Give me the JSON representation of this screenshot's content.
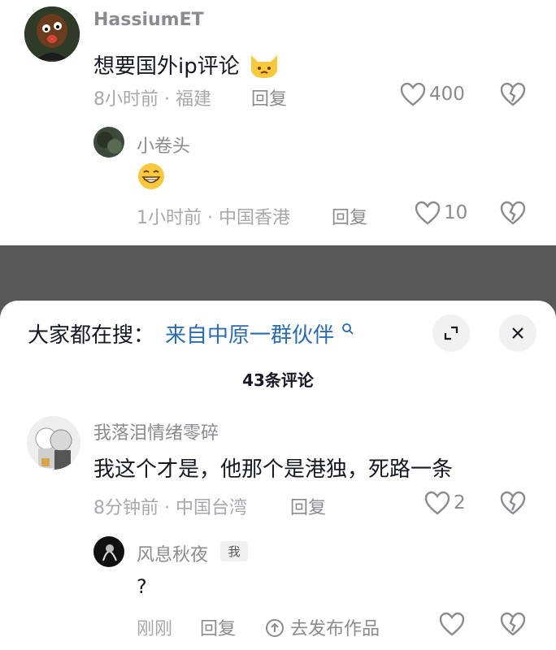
{
  "comments": [
    {
      "username": "HassiumET",
      "text": "想要国外ip评论",
      "emoji": "cat-face-emoji",
      "time": "8小时前",
      "location": "福建",
      "reply_label": "回复",
      "likes": "400",
      "reply": {
        "username": "小卷头",
        "emoji": "grin-emoji",
        "time": "1小时前",
        "location": "中国香港",
        "reply_label": "回复",
        "likes": "10"
      }
    }
  ],
  "panel": {
    "search_label": "大家都在搜：",
    "search_link": "来自中原一群伙伴",
    "comment_count": "43条评论",
    "comment": {
      "username": "我落泪情绪零碎",
      "text": "我这个才是，他那个是港独，死路一条",
      "time": "8分钟前",
      "location": "中国台湾",
      "reply_label": "回复",
      "likes": "2"
    },
    "my_reply": {
      "username": "风息秋夜",
      "tag": "我",
      "text": "?",
      "time": "刚刚",
      "reply_label": "回复",
      "share_label": "去发布作品"
    }
  },
  "meta_separator": " · ",
  "colors": {
    "link": "#2b6cb0",
    "secondary_text": "#8a8b91",
    "backdrop": "#585858"
  }
}
